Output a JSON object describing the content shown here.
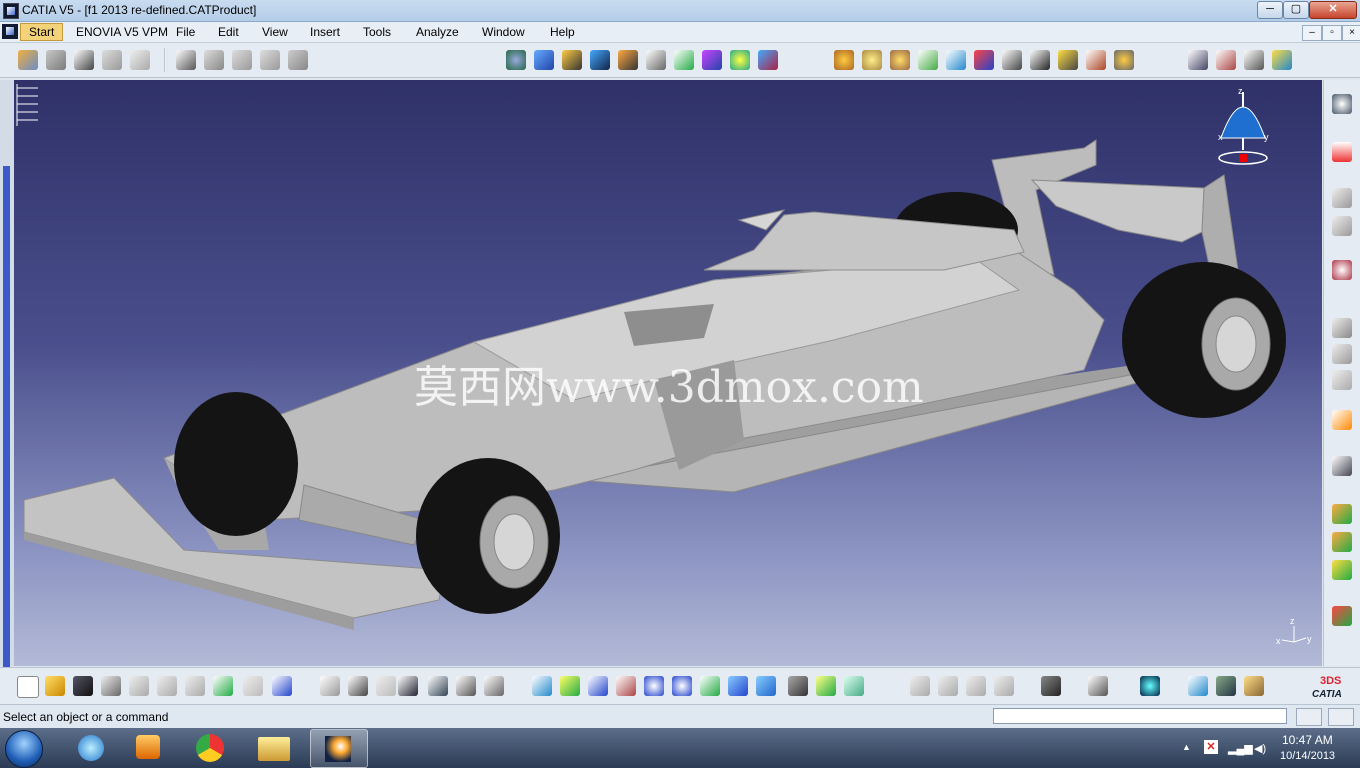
{
  "window": {
    "title": "CATIA V5 - [f1 2013 re-defined.CATProduct]",
    "min_label": "─",
    "max_label": "▢",
    "close_label": "✕"
  },
  "menu": {
    "items": [
      "Start",
      "ENOVIA V5 VPM",
      "File",
      "Edit",
      "View",
      "Insert",
      "Tools",
      "Analyze",
      "Window",
      "Help"
    ],
    "doc_min": "–",
    "doc_restore": "▫",
    "doc_close": "×"
  },
  "viewport": {
    "watermark": "莫西网www.3dmox.com",
    "compass_z": "z",
    "compass_x": "x",
    "compass_y": "y",
    "axis_z": "z",
    "axis_x": "x",
    "axis_y": "y"
  },
  "status": {
    "prompt": "Select an object or a command",
    "command_value": ""
  },
  "taskbar": {
    "time": "10:47 AM",
    "date": "10/14/2013"
  },
  "brand": {
    "catia_ds": "3DS",
    "catia_word": "CATIA"
  },
  "colors": {
    "accent_start": "#f4d27a",
    "viewport_top": "#2f3168",
    "viewport_bottom": "#b3bad7",
    "car_body": "#bdbdbd",
    "tire": "#141414"
  }
}
